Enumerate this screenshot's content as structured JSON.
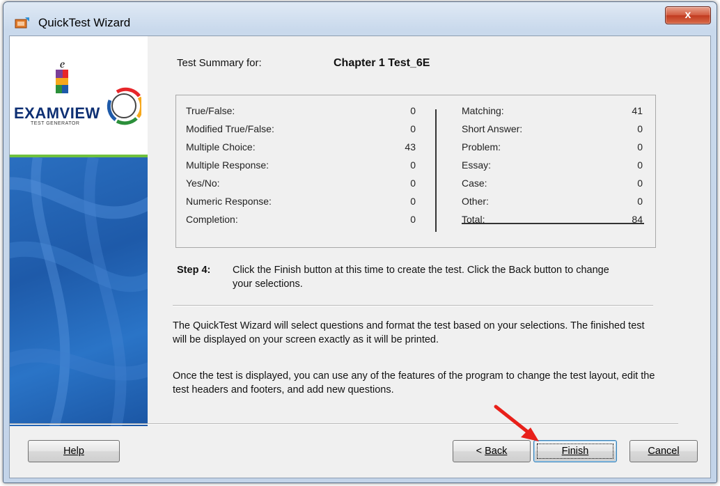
{
  "window": {
    "title": "QuickTest Wizard",
    "close_label": "x"
  },
  "logo": {
    "brand": "EXAMVIEW",
    "sub": "TEST GENERATOR"
  },
  "summary": {
    "label": "Test Summary for:",
    "test_name": "Chapter 1 Test_6E"
  },
  "counts": {
    "left": [
      {
        "label": "True/False:",
        "value": "0"
      },
      {
        "label": "Modified True/False:",
        "value": "0"
      },
      {
        "label": "Multiple Choice:",
        "value": "43"
      },
      {
        "label": "Multiple Response:",
        "value": "0"
      },
      {
        "label": "Yes/No:",
        "value": "0"
      },
      {
        "label": "Numeric Response:",
        "value": "0"
      },
      {
        "label": "Completion:",
        "value": "0"
      }
    ],
    "right": [
      {
        "label": "Matching:",
        "value": "41"
      },
      {
        "label": "Short Answer:",
        "value": "0"
      },
      {
        "label": "Problem:",
        "value": "0"
      },
      {
        "label": "Essay:",
        "value": "0"
      },
      {
        "label": "Case:",
        "value": "0"
      },
      {
        "label": "Other:",
        "value": "0"
      },
      {
        "label": "Total:",
        "value": "84"
      }
    ]
  },
  "step": {
    "label": "Step 4:",
    "text": "Click the Finish button at this time to create the test. Click the Back button to change your selections."
  },
  "paragraphs": {
    "p1": "The QuickTest Wizard will select questions and format the test based on your selections. The finished test will be displayed on your screen exactly as it will be printed.",
    "p2": "Once the test is displayed, you can use any of the features of the program to change the test layout, edit the test headers and footers, and add new questions."
  },
  "buttons": {
    "help": "Help",
    "back_prefix": "< ",
    "back": "Back",
    "finish": "Finish",
    "cancel": "Cancel"
  },
  "colors": {
    "arrow": "#e8201a",
    "logo_blue": "#1e5aa9",
    "logo_green": "#6fc13e"
  }
}
